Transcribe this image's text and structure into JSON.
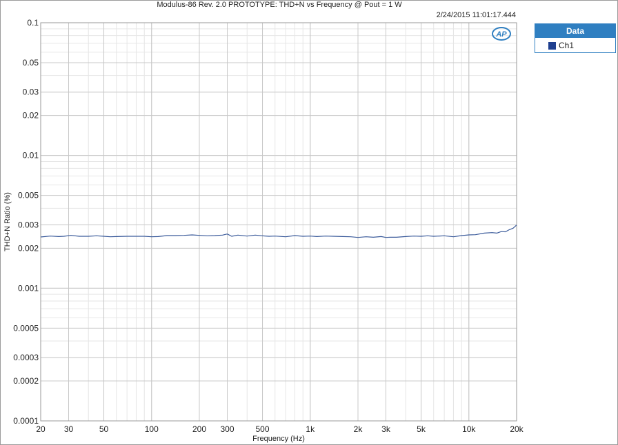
{
  "chart_data": {
    "type": "line",
    "title": "Modulus-86 Rev. 2.0 PROTOTYPE: THD+N vs Frequency @ Pout = 1 W",
    "timestamp": "2/24/2015 11:01:17.444",
    "xlabel": "Frequency (Hz)",
    "ylabel": "THD+N Ratio (%)",
    "xscale": "log",
    "yscale": "log",
    "xlim": [
      20,
      20000
    ],
    "ylim": [
      0.0001,
      0.1
    ],
    "grid": true,
    "legend_title": "Data",
    "legend_position": "right",
    "x_ticks": [
      {
        "value": 20,
        "label": "20"
      },
      {
        "value": 30,
        "label": "30"
      },
      {
        "value": 50,
        "label": "50"
      },
      {
        "value": 100,
        "label": "100"
      },
      {
        "value": 200,
        "label": "200"
      },
      {
        "value": 300,
        "label": "300"
      },
      {
        "value": 500,
        "label": "500"
      },
      {
        "value": 1000,
        "label": "1k"
      },
      {
        "value": 2000,
        "label": "2k"
      },
      {
        "value": 3000,
        "label": "3k"
      },
      {
        "value": 5000,
        "label": "5k"
      },
      {
        "value": 10000,
        "label": "10k"
      },
      {
        "value": 20000,
        "label": "20k"
      }
    ],
    "y_ticks": [
      {
        "value": 0.1,
        "label": "0.1"
      },
      {
        "value": 0.05,
        "label": "0.05"
      },
      {
        "value": 0.03,
        "label": "0.03"
      },
      {
        "value": 0.02,
        "label": "0.02"
      },
      {
        "value": 0.01,
        "label": "0.01"
      },
      {
        "value": 0.005,
        "label": "0.005"
      },
      {
        "value": 0.003,
        "label": "0.003"
      },
      {
        "value": 0.002,
        "label": "0.002"
      },
      {
        "value": 0.001,
        "label": "0.001"
      },
      {
        "value": 0.0005,
        "label": "0.0005"
      },
      {
        "value": 0.0003,
        "label": "0.0003"
      },
      {
        "value": 0.0002,
        "label": "0.0002"
      },
      {
        "value": 0.0001,
        "label": "0.0001"
      }
    ],
    "series": [
      {
        "name": "Ch1",
        "color": "#3a5a9a",
        "x": [
          20,
          23,
          26,
          28,
          31,
          35,
          40,
          45,
          50,
          55,
          60,
          70,
          80,
          90,
          100,
          110,
          125,
          140,
          160,
          180,
          200,
          225,
          250,
          280,
          300,
          320,
          350,
          400,
          450,
          500,
          550,
          600,
          700,
          800,
          900,
          1000,
          1100,
          1250,
          1400,
          1600,
          1800,
          2000,
          2250,
          2500,
          2800,
          3000,
          3200,
          3500,
          4000,
          4500,
          5000,
          5500,
          6000,
          7000,
          8000,
          9000,
          10000,
          11000,
          12500,
          14000,
          15000,
          16000,
          17000,
          18000,
          19000,
          20000
        ],
        "y": [
          0.00243,
          0.00247,
          0.00245,
          0.00246,
          0.0025,
          0.00246,
          0.00246,
          0.00248,
          0.00246,
          0.00244,
          0.00245,
          0.00246,
          0.00246,
          0.00246,
          0.00244,
          0.00245,
          0.00249,
          0.00249,
          0.0025,
          0.00252,
          0.0025,
          0.00248,
          0.00249,
          0.00251,
          0.00256,
          0.00246,
          0.00251,
          0.00247,
          0.00251,
          0.00248,
          0.00246,
          0.00247,
          0.00244,
          0.00249,
          0.00246,
          0.00247,
          0.00245,
          0.00247,
          0.00246,
          0.00245,
          0.00244,
          0.00241,
          0.00244,
          0.00242,
          0.00245,
          0.00241,
          0.00242,
          0.00242,
          0.00245,
          0.00247,
          0.00246,
          0.00248,
          0.00246,
          0.00248,
          0.00244,
          0.00249,
          0.00252,
          0.00253,
          0.0026,
          0.00262,
          0.0026,
          0.00267,
          0.00266,
          0.00276,
          0.00283,
          0.00299
        ]
      }
    ]
  }
}
